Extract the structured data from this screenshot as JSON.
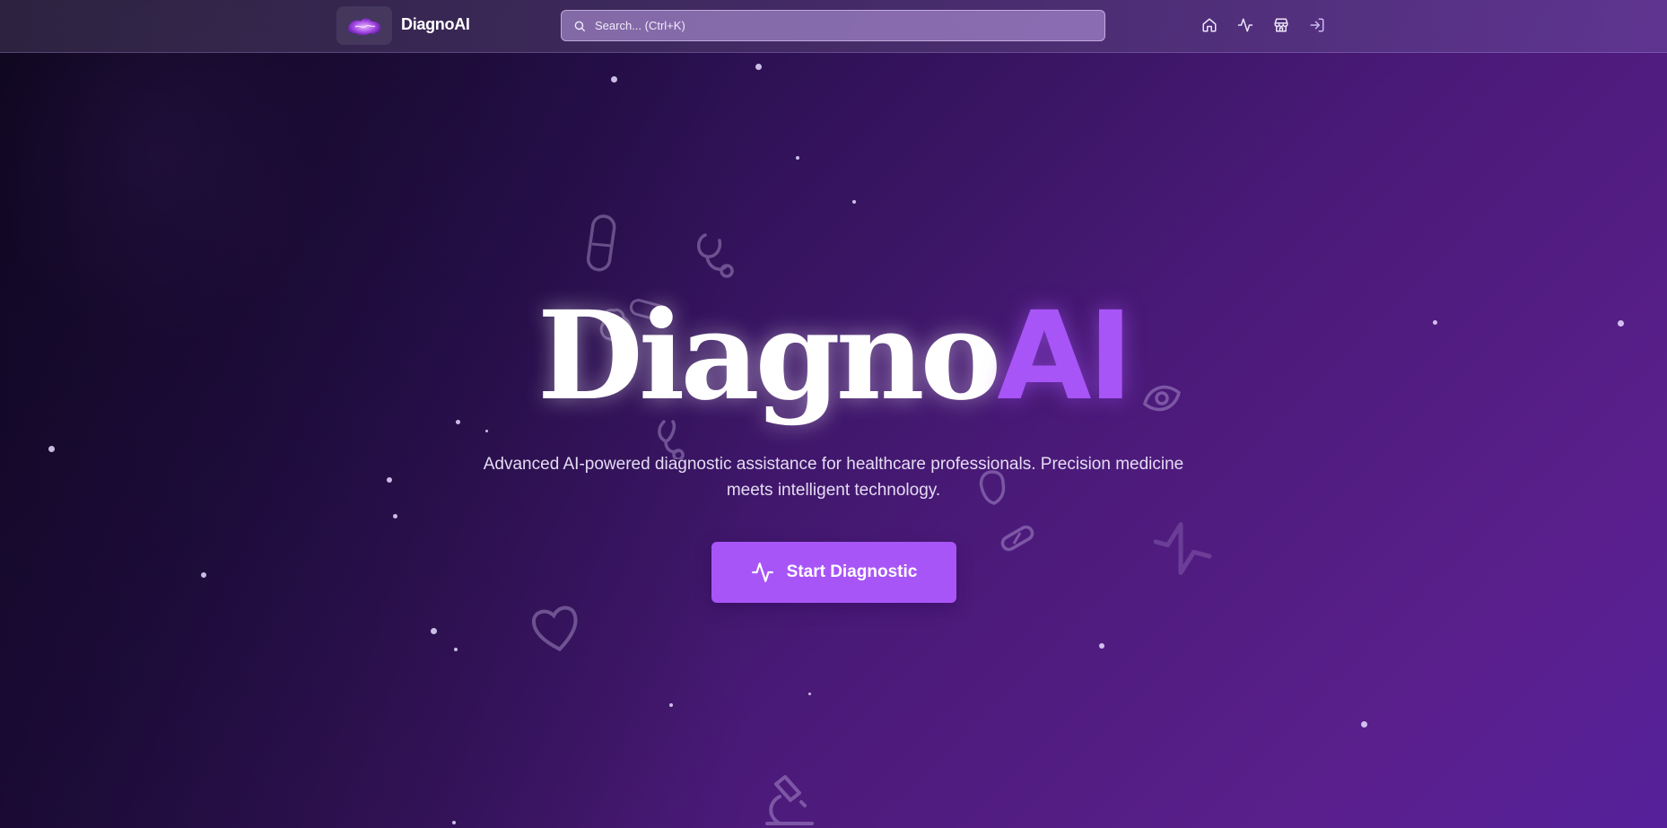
{
  "header": {
    "brand": "DiagnoAI",
    "logo_icon": "brain-cloud-logo",
    "search": {
      "placeholder": "Search... (Ctrl+K)",
      "value": ""
    },
    "nav_icons": [
      "home-icon",
      "activity-icon",
      "store-icon",
      "login-icon"
    ]
  },
  "hero": {
    "title_part1": "Diagno",
    "title_part2": "AI",
    "subtitle": "Advanced AI-powered diagnostic assistance for healthcare professionals. Precision medicine meets intelligent technology.",
    "cta_label": "Start Diagnostic",
    "cta_icon": "activity-icon"
  },
  "colors": {
    "accent": "#a855f7",
    "background_dark": "#150a28",
    "background_light": "#5a1f8c"
  },
  "decorations": [
    "pill-icon",
    "stethoscope-icon",
    "heart-icon",
    "eye-icon",
    "microscope-icon",
    "brain-icon",
    "activity-icon"
  ]
}
